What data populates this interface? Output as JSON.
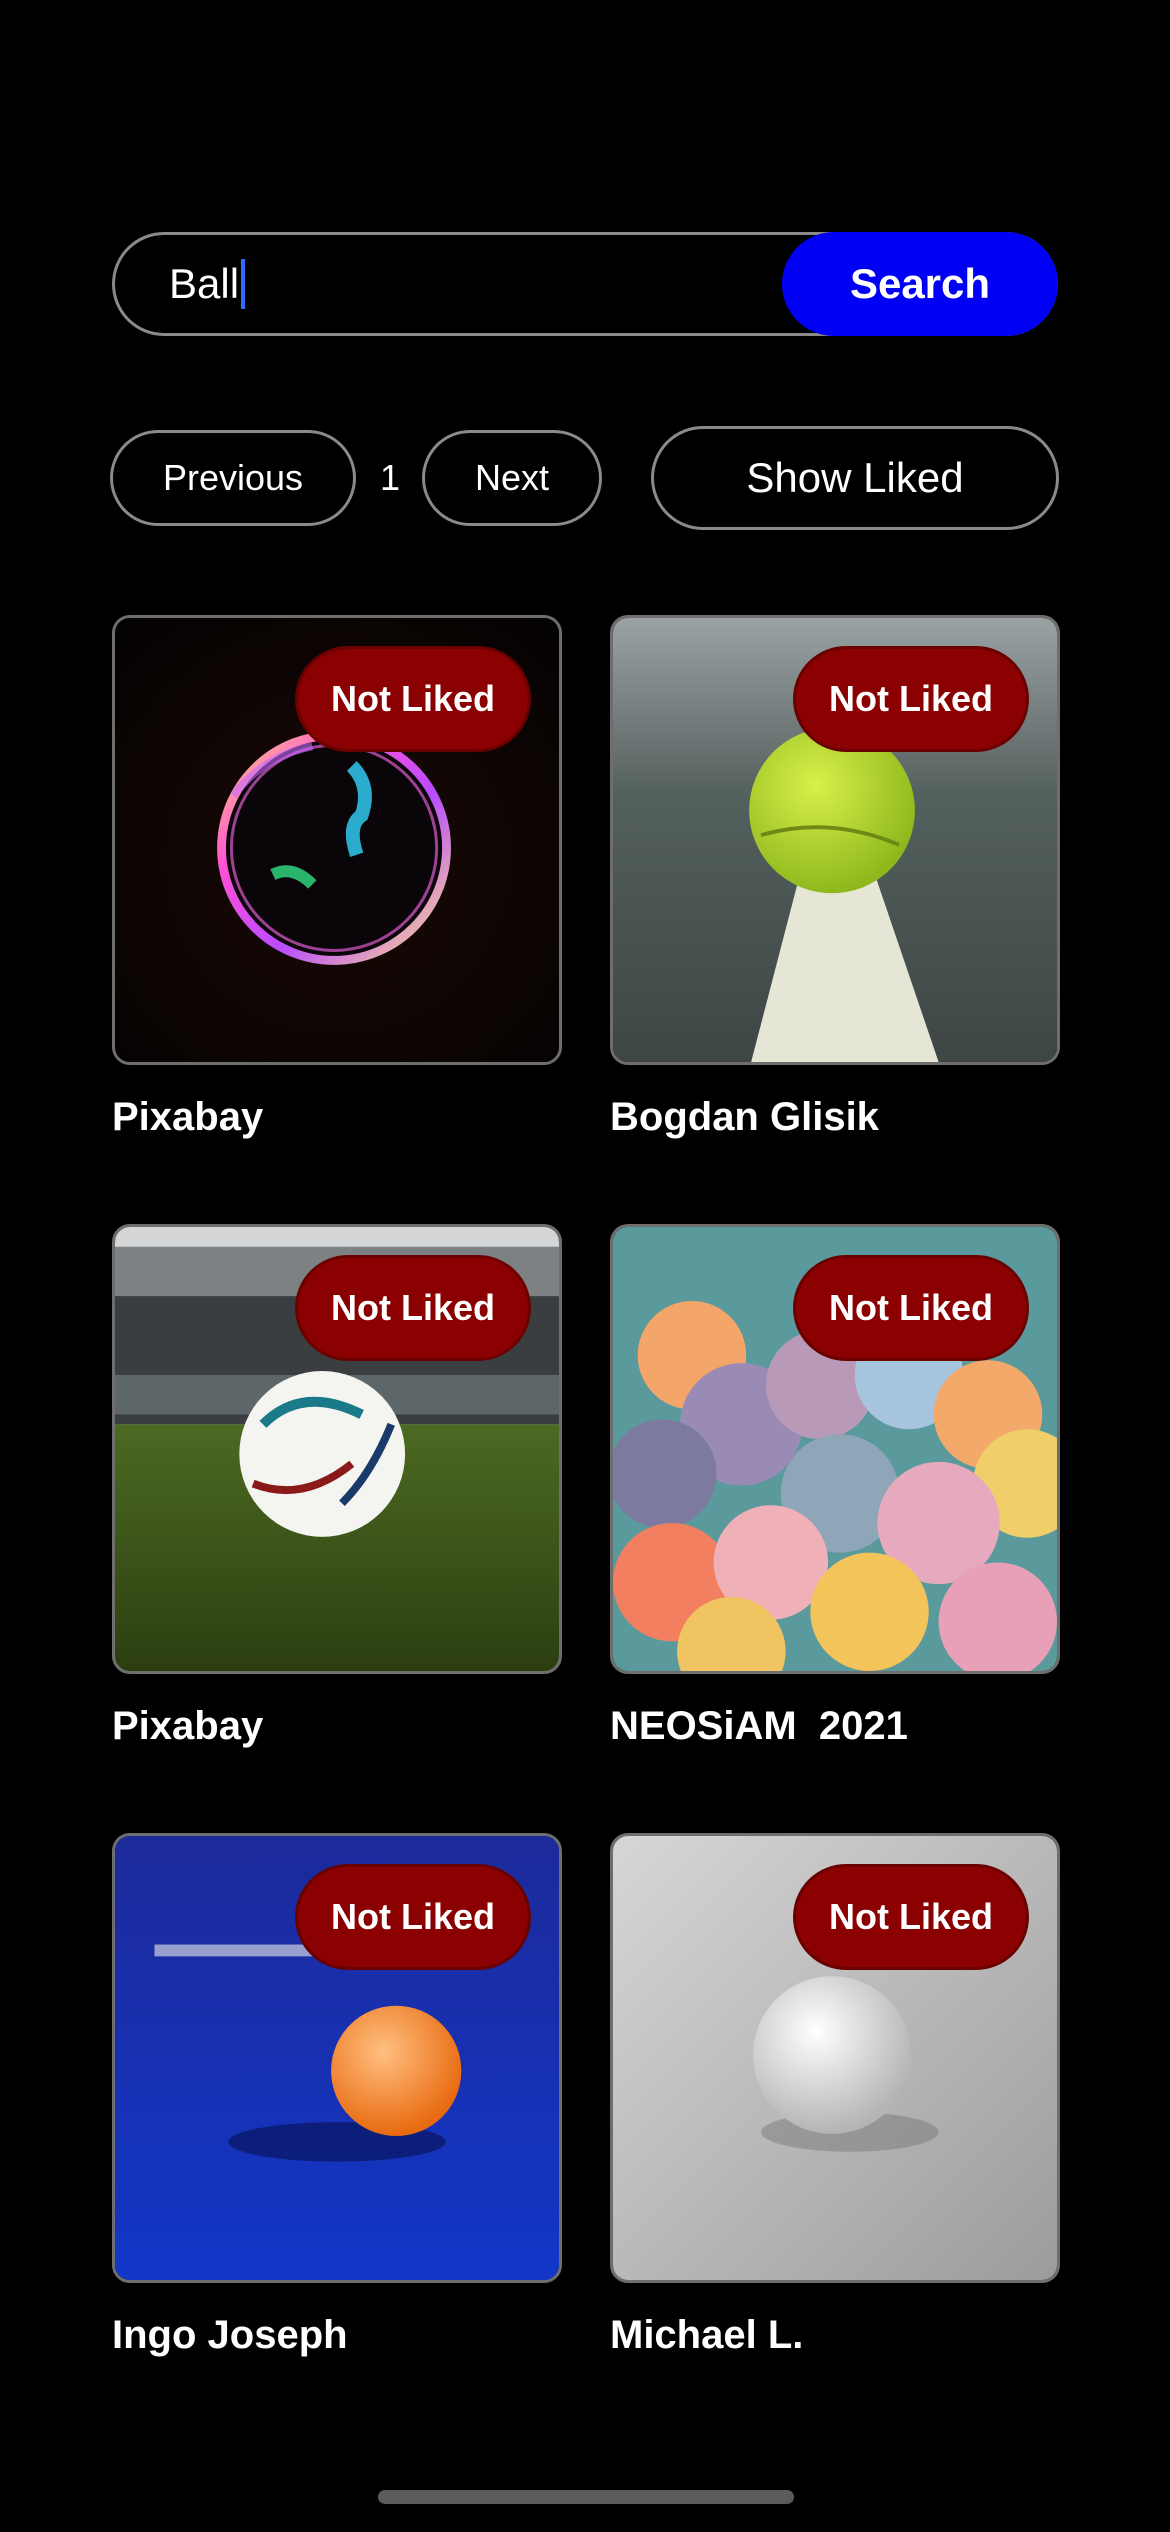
{
  "search": {
    "value": "Ball",
    "button_label": "Search"
  },
  "pagination": {
    "previous_label": "Previous",
    "page": "1",
    "next_label": "Next"
  },
  "filter": {
    "show_liked_label": "Show Liked"
  },
  "results": [
    {
      "author": "Pixabay",
      "like_label": "Not Liked",
      "subject": "soap bubble"
    },
    {
      "author": "Bogdan Glisik",
      "like_label": "Not Liked",
      "subject": "tennis ball"
    },
    {
      "author": "Pixabay",
      "like_label": "Not Liked",
      "subject": "soccer ball"
    },
    {
      "author": "NEOSiAM  2021",
      "like_label": "Not Liked",
      "subject": "ball pit balls"
    },
    {
      "author": "Ingo Joseph",
      "like_label": "Not Liked",
      "subject": "ping pong ball"
    },
    {
      "author": "Michael L.",
      "like_label": "Not Liked",
      "subject": "white ball"
    }
  ],
  "colors": {
    "background": "#000000",
    "search_button": "#0000f5",
    "not_liked_badge": "#8b0000",
    "border": "#8a8a8a"
  }
}
